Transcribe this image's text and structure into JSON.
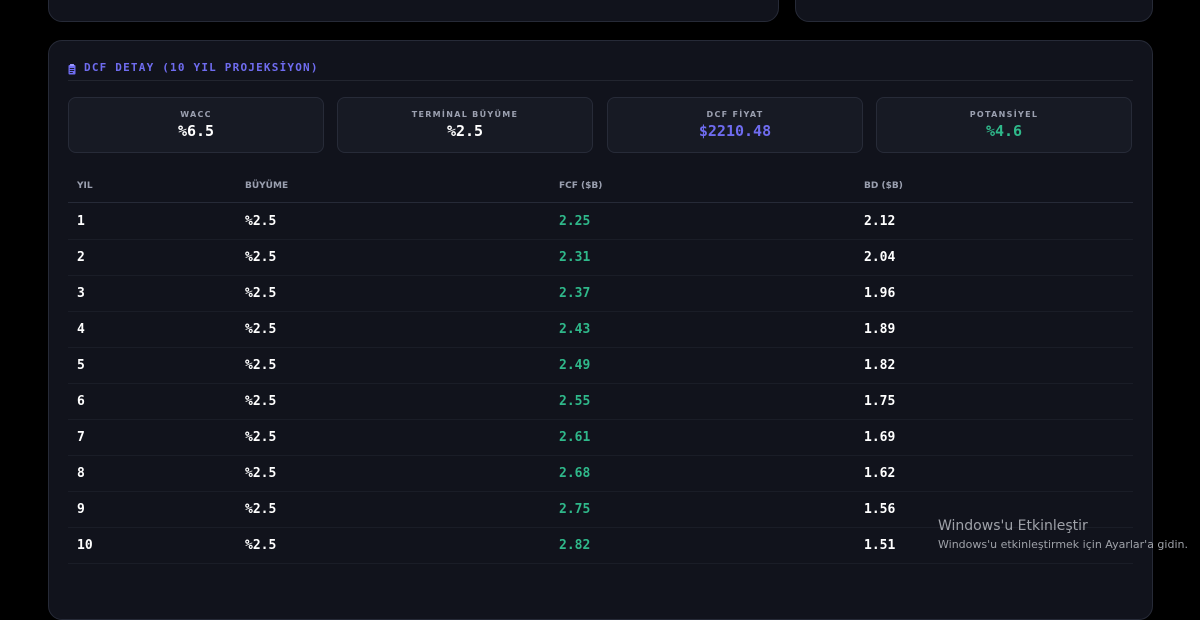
{
  "panel": {
    "title": "DCF DETAY (10 YIL PROJEKSİYON)",
    "icon": "clipboard-icon"
  },
  "metrics": [
    {
      "label": "WACC",
      "value": "%6.5",
      "color": "#ffffff"
    },
    {
      "label": "TERMİNAL BÜYÜME",
      "value": "%2.5",
      "color": "#ffffff"
    },
    {
      "label": "DCF FİYAT",
      "value": "$2210.48",
      "color": "#6f6cf0"
    },
    {
      "label": "POTANSİYEL",
      "value": "%4.6",
      "color": "#2fb88a"
    }
  ],
  "table": {
    "headers": [
      "YIL",
      "BÜYÜME",
      "FCF ($B)",
      "BD ($B)"
    ],
    "rows": [
      [
        "1",
        "%2.5",
        "2.25",
        "2.12"
      ],
      [
        "2",
        "%2.5",
        "2.31",
        "2.04"
      ],
      [
        "3",
        "%2.5",
        "2.37",
        "1.96"
      ],
      [
        "4",
        "%2.5",
        "2.43",
        "1.89"
      ],
      [
        "5",
        "%2.5",
        "2.49",
        "1.82"
      ],
      [
        "6",
        "%2.5",
        "2.55",
        "1.75"
      ],
      [
        "7",
        "%2.5",
        "2.61",
        "1.69"
      ],
      [
        "8",
        "%2.5",
        "2.68",
        "1.62"
      ],
      [
        "9",
        "%2.5",
        "2.75",
        "1.56"
      ],
      [
        "10",
        "%2.5",
        "2.82",
        "1.51"
      ]
    ]
  },
  "watermark": {
    "title": "Windows'u Etkinleştir",
    "subtitle": "Windows'u etkinleştirmek için Ayarlar'a gidin."
  },
  "colors": {
    "accent": "#6f6cf0",
    "positive": "#2fb88a"
  }
}
